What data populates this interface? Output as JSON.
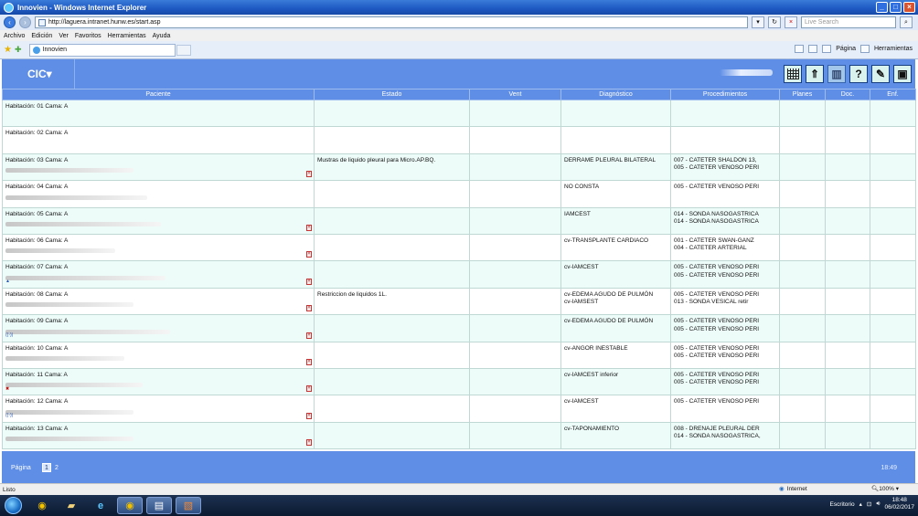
{
  "window": {
    "title": "Innovien - Windows Internet Explorer"
  },
  "address": {
    "url": "http://laguera.intranet.hunw.es/start.asp",
    "search_placeholder": "Live Search"
  },
  "menu": [
    "Archivo",
    "Edición",
    "Ver",
    "Favoritos",
    "Herramientas",
    "Ayuda"
  ],
  "tab": {
    "label": "Innovien"
  },
  "commands": {
    "page": "Página",
    "tools": "Herramientas"
  },
  "app": {
    "logo": "CIC"
  },
  "columns": [
    "Paciente",
    "Estado",
    "Vent",
    "Diagnóstico",
    "Procedimientos",
    "Planes",
    "Doc.",
    "Enf."
  ],
  "rows": [
    {
      "hab": "Habitación: 01   Cama: A",
      "estado": "",
      "diag": "",
      "proc": "",
      "blur": false,
      "del": false
    },
    {
      "hab": "Habitación: 02   Cama: A",
      "estado": "",
      "diag": "",
      "proc": "",
      "blur": false,
      "del": false
    },
    {
      "hab": "Habitación: 03   Cama: A",
      "estado": "Mustras de liquido pleural para Micro.AP.BQ.",
      "diag": "DERRAME PLEURAL BILATERAL",
      "proc": "007 - CATETER SHALDON 13,\n005 - CATETER VENOSO PERI",
      "blur": true,
      "del": true
    },
    {
      "hab": "Habitación: 04   Cama: A",
      "estado": "",
      "diag": "NO CONSTA",
      "proc": "005 - CATETER VENOSO PERI",
      "blur": true,
      "del": false
    },
    {
      "hab": "Habitación: 05   Cama: A",
      "estado": "",
      "diag": "IAMCEST",
      "proc": "014 - SONDA NASOGASTRICA\n014 - SONDA NASOGASTRICA",
      "blur": true,
      "del": true
    },
    {
      "hab": "Habitación: 06   Cama: A",
      "estado": "",
      "diag": "cv-TRANSPLANTE CARDIACO",
      "proc": "001 - CATETER SWAN-GANZ\n004 - CATETER ARTERIAL",
      "blur": true,
      "del": true
    },
    {
      "hab": "Habitación: 07   Cama: A",
      "estado": "",
      "diag": "cv-IAMCEST",
      "proc": "005 - CATETER VENOSO PERI\n005 - CATETER VENOSO PERI",
      "blur": true,
      "del": true
    },
    {
      "hab": "Habitación: 08   Cama: A",
      "estado": "Restriccion de liquidos 1L.",
      "diag": "cv-EDEMA AGUDO DE PULMÓN\ncv-IAMSEST",
      "proc": "005 - CATETER VENOSO PERI\n013 - SONDA VESICAL retir",
      "blur": true,
      "del": true
    },
    {
      "hab": "Habitación: 09   Cama: A",
      "estado": "",
      "diag": "cv-EDEMA AGUDO DE PULMÓN",
      "proc": "005 - CATETER VENOSO PERI\n005 - CATETER VENOSO PERI",
      "blur": true,
      "del": true
    },
    {
      "hab": "Habitación: 10   Cama: A",
      "estado": "",
      "diag": "cv-ANGOR INESTABLE",
      "proc": "005 - CATETER VENOSO PERI\n005 - CATETER VENOSO PERI",
      "blur": true,
      "del": true
    },
    {
      "hab": "Habitación: 11   Cama: A",
      "estado": "",
      "diag": "cv-IAMCEST inferior",
      "proc": "005 - CATETER VENOSO PERI\n005 - CATETER VENOSO PERI",
      "blur": true,
      "del": true
    },
    {
      "hab": "Habitación: 12   Cama: A",
      "estado": "",
      "diag": "cv-IAMCEST",
      "proc": "005 - CATETER VENOSO PERI",
      "blur": true,
      "del": true
    },
    {
      "hab": "Habitación: 13   Cama: A",
      "estado": "",
      "diag": "cv-TAPONAMIENTO",
      "proc": "008 - DRENAJE PLEURAL DER\n014 - SONDA NASOGASTRICA,",
      "blur": true,
      "del": true
    }
  ],
  "pagination": {
    "label": "Página",
    "current": "1",
    "next": "2"
  },
  "footer": {
    "time": "18:49"
  },
  "status": {
    "left": "Listo",
    "zone": "Internet",
    "zoom": "100%"
  },
  "taskbar": {
    "desktop": "Escritorio",
    "time": "18:48",
    "date": "06/02/2017"
  }
}
